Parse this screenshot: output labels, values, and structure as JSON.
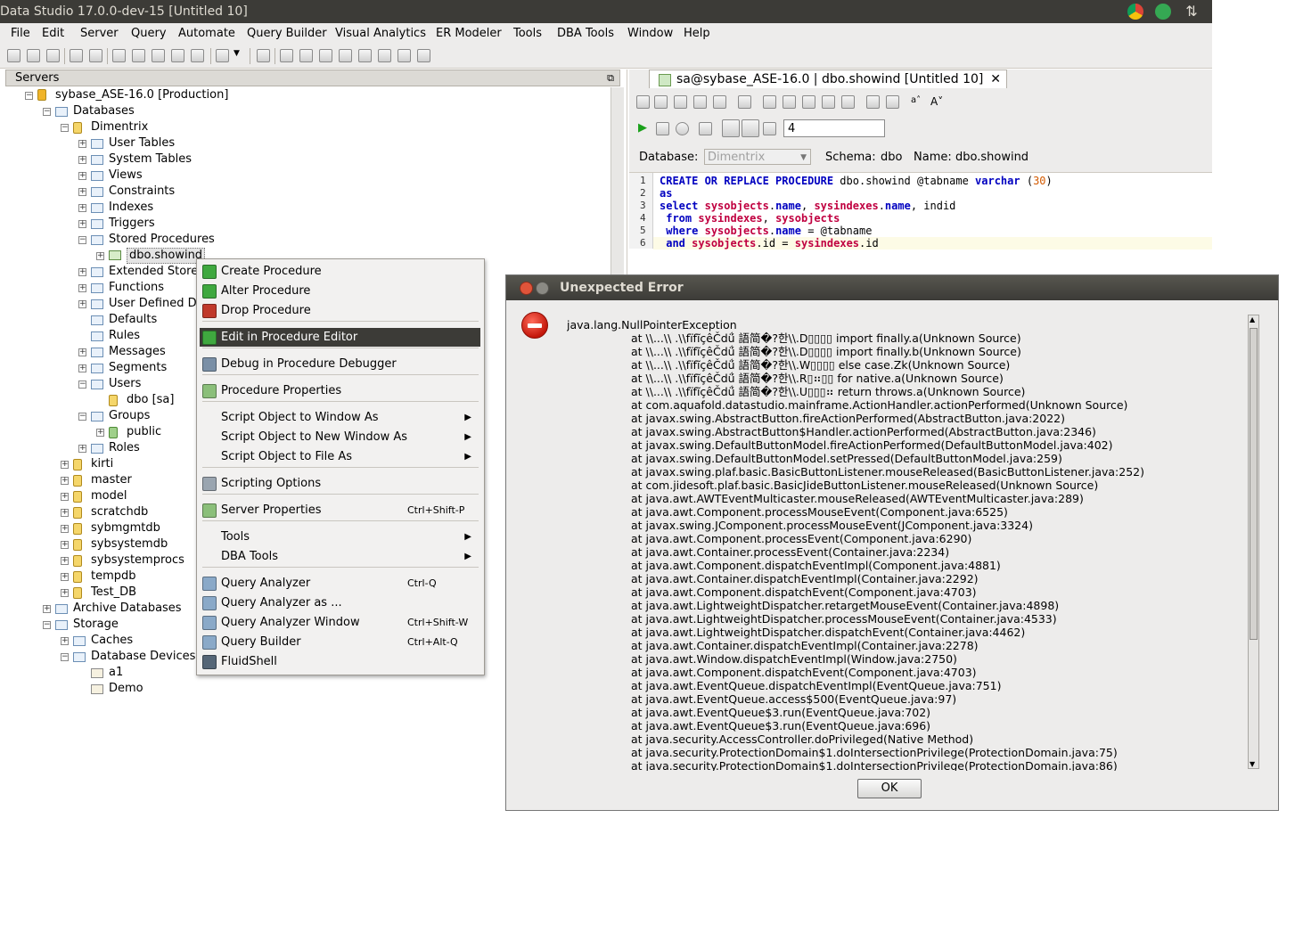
{
  "window": {
    "title": "Data Studio 17.0.0-dev-15 [Untitled 10]"
  },
  "menubar": [
    "File",
    "Edit",
    "Server",
    "Query",
    "Automate",
    "Query Builder",
    "Visual Analytics",
    "ER Modeler",
    "Tools",
    "DBA Tools",
    "Window",
    "Help"
  ],
  "left_panel": {
    "header": "Servers"
  },
  "tree": [
    {
      "label": "sybase_ASE-16.0 [Production]"
    },
    {
      "label": "Databases"
    },
    {
      "label": "Dimentrix"
    },
    {
      "label": "User Tables"
    },
    {
      "label": "System Tables"
    },
    {
      "label": "Views"
    },
    {
      "label": "Constraints"
    },
    {
      "label": "Indexes"
    },
    {
      "label": "Triggers"
    },
    {
      "label": "Stored Procedures"
    },
    {
      "label": "dbo.showind"
    },
    {
      "label": "Extended Store"
    },
    {
      "label": "Functions"
    },
    {
      "label": "User Defined D"
    },
    {
      "label": "Defaults"
    },
    {
      "label": "Rules"
    },
    {
      "label": "Messages"
    },
    {
      "label": "Segments"
    },
    {
      "label": "Users"
    },
    {
      "label": "dbo [sa]"
    },
    {
      "label": "Groups"
    },
    {
      "label": "public"
    },
    {
      "label": "Roles"
    },
    {
      "label": "kirti"
    },
    {
      "label": "master"
    },
    {
      "label": "model"
    },
    {
      "label": "scratchdb"
    },
    {
      "label": "sybmgmtdb"
    },
    {
      "label": "sybsystemdb"
    },
    {
      "label": "sybsystemprocs"
    },
    {
      "label": "tempdb"
    },
    {
      "label": "Test_DB"
    },
    {
      "label": "Archive Databases"
    },
    {
      "label": "Storage"
    },
    {
      "label": "Caches"
    },
    {
      "label": "Database Devices"
    },
    {
      "label": "a1"
    },
    {
      "label": "Demo"
    }
  ],
  "editor": {
    "tab_title": "sa@sybase_ASE-16.0 | dbo.showind [Untitled 10]",
    "close": "✕",
    "limit_value": "4",
    "database_label": "Database:",
    "database_value": "Dimentrix",
    "schema_label": "Schema:",
    "schema_value": "dbo",
    "name_label": "Name:",
    "name_value": "dbo.showind",
    "line_numbers": [
      "1",
      "2",
      "3",
      "4",
      "5",
      "6"
    ]
  },
  "context_menu": {
    "items": [
      {
        "label": "Create Procedure"
      },
      {
        "label": "Alter Procedure"
      },
      {
        "label": "Drop Procedure"
      },
      {
        "label": "Edit in Procedure Editor"
      },
      {
        "label": "Debug in Procedure Debugger"
      },
      {
        "label": "Procedure Properties"
      },
      {
        "label": "Script Object to Window As"
      },
      {
        "label": "Script Object to New Window As"
      },
      {
        "label": "Script Object to File As"
      },
      {
        "label": "Scripting Options"
      },
      {
        "label": "Server Properties",
        "shortcut": "Ctrl+Shift-P"
      },
      {
        "label": "Tools"
      },
      {
        "label": "DBA Tools"
      },
      {
        "label": "Query Analyzer",
        "shortcut": "Ctrl-Q"
      },
      {
        "label": "Query Analyzer as ..."
      },
      {
        "label": "Query Analyzer Window",
        "shortcut": "Ctrl+Shift-W"
      },
      {
        "label": "Query Builder",
        "shortcut": "Ctrl+Alt-Q"
      },
      {
        "label": "FluidShell"
      }
    ]
  },
  "dialog": {
    "title": "Unexpected Error",
    "ok": "OK",
    "trace": [
      "java.lang.NullPointerException",
      "at \\\\...\\\\ .\\\\fïfĩçêČdǘ́ 語简�?한\\\\.D▯▯▯▯ import finally.a(Unknown Source)",
      "at \\\\...\\\\ .\\\\fïfĩçêČdǘ́ 語简�?한\\\\.D▯▯▯▯ import finally.b(Unknown Source)",
      "at \\\\...\\\\ .\\\\fïfĩçêČdǘ́ 語简�?한\\\\.W▯▯▯▯ else case.Zk(Unknown Source)",
      "at \\\\...\\\\ .\\\\fïfĩçêČdǘ́ 語简�?한\\\\.R▯⠶▯▯ for native.a(Unknown Source)",
      "at \\\\...\\\\ .\\\\fïfĩçêČdǘ́ 語简�?한\\\\.U▯▯▯⠶ return throws.a(Unknown Source)",
      "at com.aquafold.datastudio.mainframe.ActionHandler.actionPerformed(Unknown Source)",
      "at javax.swing.AbstractButton.fireActionPerformed(AbstractButton.java:2022)",
      "at javax.swing.AbstractButton$Handler.actionPerformed(AbstractButton.java:2346)",
      "at javax.swing.DefaultButtonModel.fireActionPerformed(DefaultButtonModel.java:402)",
      "at javax.swing.DefaultButtonModel.setPressed(DefaultButtonModel.java:259)",
      "at javax.swing.plaf.basic.BasicButtonListener.mouseReleased(BasicButtonListener.java:252)",
      "at com.jidesoft.plaf.basic.BasicJideButtonListener.mouseReleased(Unknown Source)",
      "at java.awt.AWTEventMulticaster.mouseReleased(AWTEventMulticaster.java:289)",
      "at java.awt.Component.processMouseEvent(Component.java:6525)",
      "at javax.swing.JComponent.processMouseEvent(JComponent.java:3324)",
      "at java.awt.Component.processEvent(Component.java:6290)",
      "at java.awt.Container.processEvent(Container.java:2234)",
      "at java.awt.Component.dispatchEventImpl(Component.java:4881)",
      "at java.awt.Container.dispatchEventImpl(Container.java:2292)",
      "at java.awt.Component.dispatchEvent(Component.java:4703)",
      "at java.awt.LightweightDispatcher.retargetMouseEvent(Container.java:4898)",
      "at java.awt.LightweightDispatcher.processMouseEvent(Container.java:4533)",
      "at java.awt.LightweightDispatcher.dispatchEvent(Container.java:4462)",
      "at java.awt.Container.dispatchEventImpl(Container.java:2278)",
      "at java.awt.Window.dispatchEventImpl(Window.java:2750)",
      "at java.awt.Component.dispatchEvent(Component.java:4703)",
      "at java.awt.EventQueue.dispatchEventImpl(EventQueue.java:751)",
      "at java.awt.EventQueue.access$500(EventQueue.java:97)",
      "at java.awt.EventQueue$3.run(EventQueue.java:702)",
      "at java.awt.EventQueue$3.run(EventQueue.java:696)",
      "at java.security.AccessController.doPrivileged(Native Method)",
      "at java.security.ProtectionDomain$1.doIntersectionPrivilege(ProtectionDomain.java:75)",
      "at java.security.ProtectionDomain$1.doIntersectionPrivilege(ProtectionDomain.java:86)"
    ]
  },
  "colors": {
    "titlebar": "#3c3b37",
    "menu_selected": "#3c3b37",
    "error_red": "#c4170b",
    "keyword_blue": "#0000c0",
    "object_red": "#c00040"
  },
  "icons": [
    "chrome-icon",
    "hangouts-icon",
    "network-arrows-icon",
    "error-stop-icon"
  ]
}
